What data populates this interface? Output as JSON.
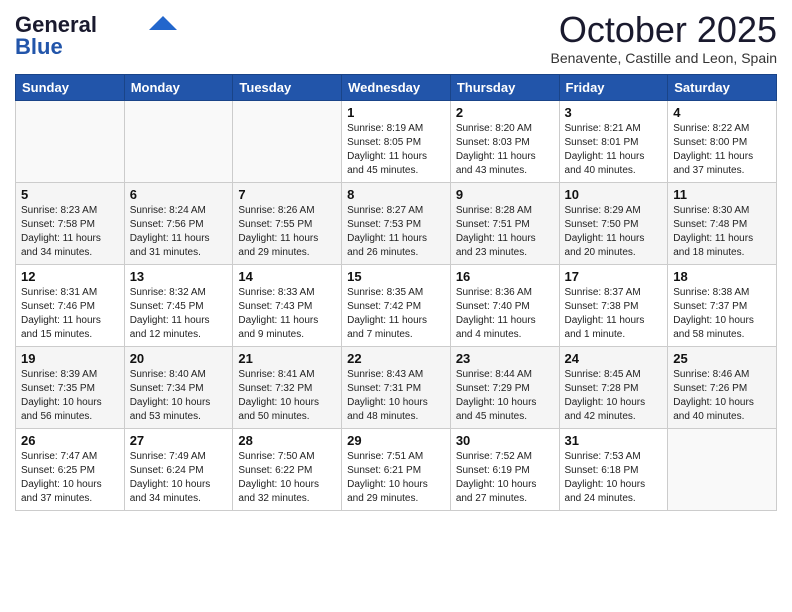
{
  "header": {
    "logo_line1": "General",
    "logo_line2": "Blue",
    "month": "October 2025",
    "location": "Benavente, Castille and Leon, Spain"
  },
  "weekdays": [
    "Sunday",
    "Monday",
    "Tuesday",
    "Wednesday",
    "Thursday",
    "Friday",
    "Saturday"
  ],
  "weeks": [
    [
      {
        "day": "",
        "info": ""
      },
      {
        "day": "",
        "info": ""
      },
      {
        "day": "",
        "info": ""
      },
      {
        "day": "1",
        "info": "Sunrise: 8:19 AM\nSunset: 8:05 PM\nDaylight: 11 hours\nand 45 minutes."
      },
      {
        "day": "2",
        "info": "Sunrise: 8:20 AM\nSunset: 8:03 PM\nDaylight: 11 hours\nand 43 minutes."
      },
      {
        "day": "3",
        "info": "Sunrise: 8:21 AM\nSunset: 8:01 PM\nDaylight: 11 hours\nand 40 minutes."
      },
      {
        "day": "4",
        "info": "Sunrise: 8:22 AM\nSunset: 8:00 PM\nDaylight: 11 hours\nand 37 minutes."
      }
    ],
    [
      {
        "day": "5",
        "info": "Sunrise: 8:23 AM\nSunset: 7:58 PM\nDaylight: 11 hours\nand 34 minutes."
      },
      {
        "day": "6",
        "info": "Sunrise: 8:24 AM\nSunset: 7:56 PM\nDaylight: 11 hours\nand 31 minutes."
      },
      {
        "day": "7",
        "info": "Sunrise: 8:26 AM\nSunset: 7:55 PM\nDaylight: 11 hours\nand 29 minutes."
      },
      {
        "day": "8",
        "info": "Sunrise: 8:27 AM\nSunset: 7:53 PM\nDaylight: 11 hours\nand 26 minutes."
      },
      {
        "day": "9",
        "info": "Sunrise: 8:28 AM\nSunset: 7:51 PM\nDaylight: 11 hours\nand 23 minutes."
      },
      {
        "day": "10",
        "info": "Sunrise: 8:29 AM\nSunset: 7:50 PM\nDaylight: 11 hours\nand 20 minutes."
      },
      {
        "day": "11",
        "info": "Sunrise: 8:30 AM\nSunset: 7:48 PM\nDaylight: 11 hours\nand 18 minutes."
      }
    ],
    [
      {
        "day": "12",
        "info": "Sunrise: 8:31 AM\nSunset: 7:46 PM\nDaylight: 11 hours\nand 15 minutes."
      },
      {
        "day": "13",
        "info": "Sunrise: 8:32 AM\nSunset: 7:45 PM\nDaylight: 11 hours\nand 12 minutes."
      },
      {
        "day": "14",
        "info": "Sunrise: 8:33 AM\nSunset: 7:43 PM\nDaylight: 11 hours\nand 9 minutes."
      },
      {
        "day": "15",
        "info": "Sunrise: 8:35 AM\nSunset: 7:42 PM\nDaylight: 11 hours\nand 7 minutes."
      },
      {
        "day": "16",
        "info": "Sunrise: 8:36 AM\nSunset: 7:40 PM\nDaylight: 11 hours\nand 4 minutes."
      },
      {
        "day": "17",
        "info": "Sunrise: 8:37 AM\nSunset: 7:38 PM\nDaylight: 11 hours\nand 1 minute."
      },
      {
        "day": "18",
        "info": "Sunrise: 8:38 AM\nSunset: 7:37 PM\nDaylight: 10 hours\nand 58 minutes."
      }
    ],
    [
      {
        "day": "19",
        "info": "Sunrise: 8:39 AM\nSunset: 7:35 PM\nDaylight: 10 hours\nand 56 minutes."
      },
      {
        "day": "20",
        "info": "Sunrise: 8:40 AM\nSunset: 7:34 PM\nDaylight: 10 hours\nand 53 minutes."
      },
      {
        "day": "21",
        "info": "Sunrise: 8:41 AM\nSunset: 7:32 PM\nDaylight: 10 hours\nand 50 minutes."
      },
      {
        "day": "22",
        "info": "Sunrise: 8:43 AM\nSunset: 7:31 PM\nDaylight: 10 hours\nand 48 minutes."
      },
      {
        "day": "23",
        "info": "Sunrise: 8:44 AM\nSunset: 7:29 PM\nDaylight: 10 hours\nand 45 minutes."
      },
      {
        "day": "24",
        "info": "Sunrise: 8:45 AM\nSunset: 7:28 PM\nDaylight: 10 hours\nand 42 minutes."
      },
      {
        "day": "25",
        "info": "Sunrise: 8:46 AM\nSunset: 7:26 PM\nDaylight: 10 hours\nand 40 minutes."
      }
    ],
    [
      {
        "day": "26",
        "info": "Sunrise: 7:47 AM\nSunset: 6:25 PM\nDaylight: 10 hours\nand 37 minutes."
      },
      {
        "day": "27",
        "info": "Sunrise: 7:49 AM\nSunset: 6:24 PM\nDaylight: 10 hours\nand 34 minutes."
      },
      {
        "day": "28",
        "info": "Sunrise: 7:50 AM\nSunset: 6:22 PM\nDaylight: 10 hours\nand 32 minutes."
      },
      {
        "day": "29",
        "info": "Sunrise: 7:51 AM\nSunset: 6:21 PM\nDaylight: 10 hours\nand 29 minutes."
      },
      {
        "day": "30",
        "info": "Sunrise: 7:52 AM\nSunset: 6:19 PM\nDaylight: 10 hours\nand 27 minutes."
      },
      {
        "day": "31",
        "info": "Sunrise: 7:53 AM\nSunset: 6:18 PM\nDaylight: 10 hours\nand 24 minutes."
      },
      {
        "day": "",
        "info": ""
      }
    ]
  ]
}
